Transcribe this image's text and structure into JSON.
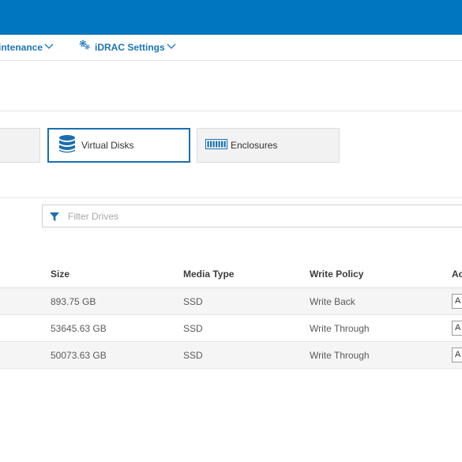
{
  "nav": {
    "maintenance_label": "intenance",
    "idrac_label": "iDRAC Settings",
    "icons": {
      "dropdown": "chevron-down-icon",
      "settings": "gears-icon"
    }
  },
  "tiles": {
    "virtual_disks_label": "Virtual Disks",
    "enclosures_label": "Enclosures",
    "icons": {
      "virtual_disks": "database-icon",
      "enclosures": "enclosure-icon"
    }
  },
  "filter": {
    "placeholder": "Filter Drives",
    "icon": "filter-icon"
  },
  "table": {
    "headers": {
      "size": "Size",
      "media_type": "Media Type",
      "write_policy": "Write Policy",
      "actions": "Ac"
    },
    "rows": [
      {
        "size": "893.75 GB",
        "media_type": "SSD",
        "write_policy": "Write Back",
        "action": "A"
      },
      {
        "size": "53645.63 GB",
        "media_type": "SSD",
        "write_policy": "Write Through",
        "action": "A"
      },
      {
        "size": "50073.63 GB",
        "media_type": "SSD",
        "write_policy": "Write Through",
        "action": "A"
      }
    ]
  },
  "colors": {
    "brand_blue": "#0076c0",
    "link_blue": "#1a75b8",
    "selected_border": "#1a6fae"
  }
}
